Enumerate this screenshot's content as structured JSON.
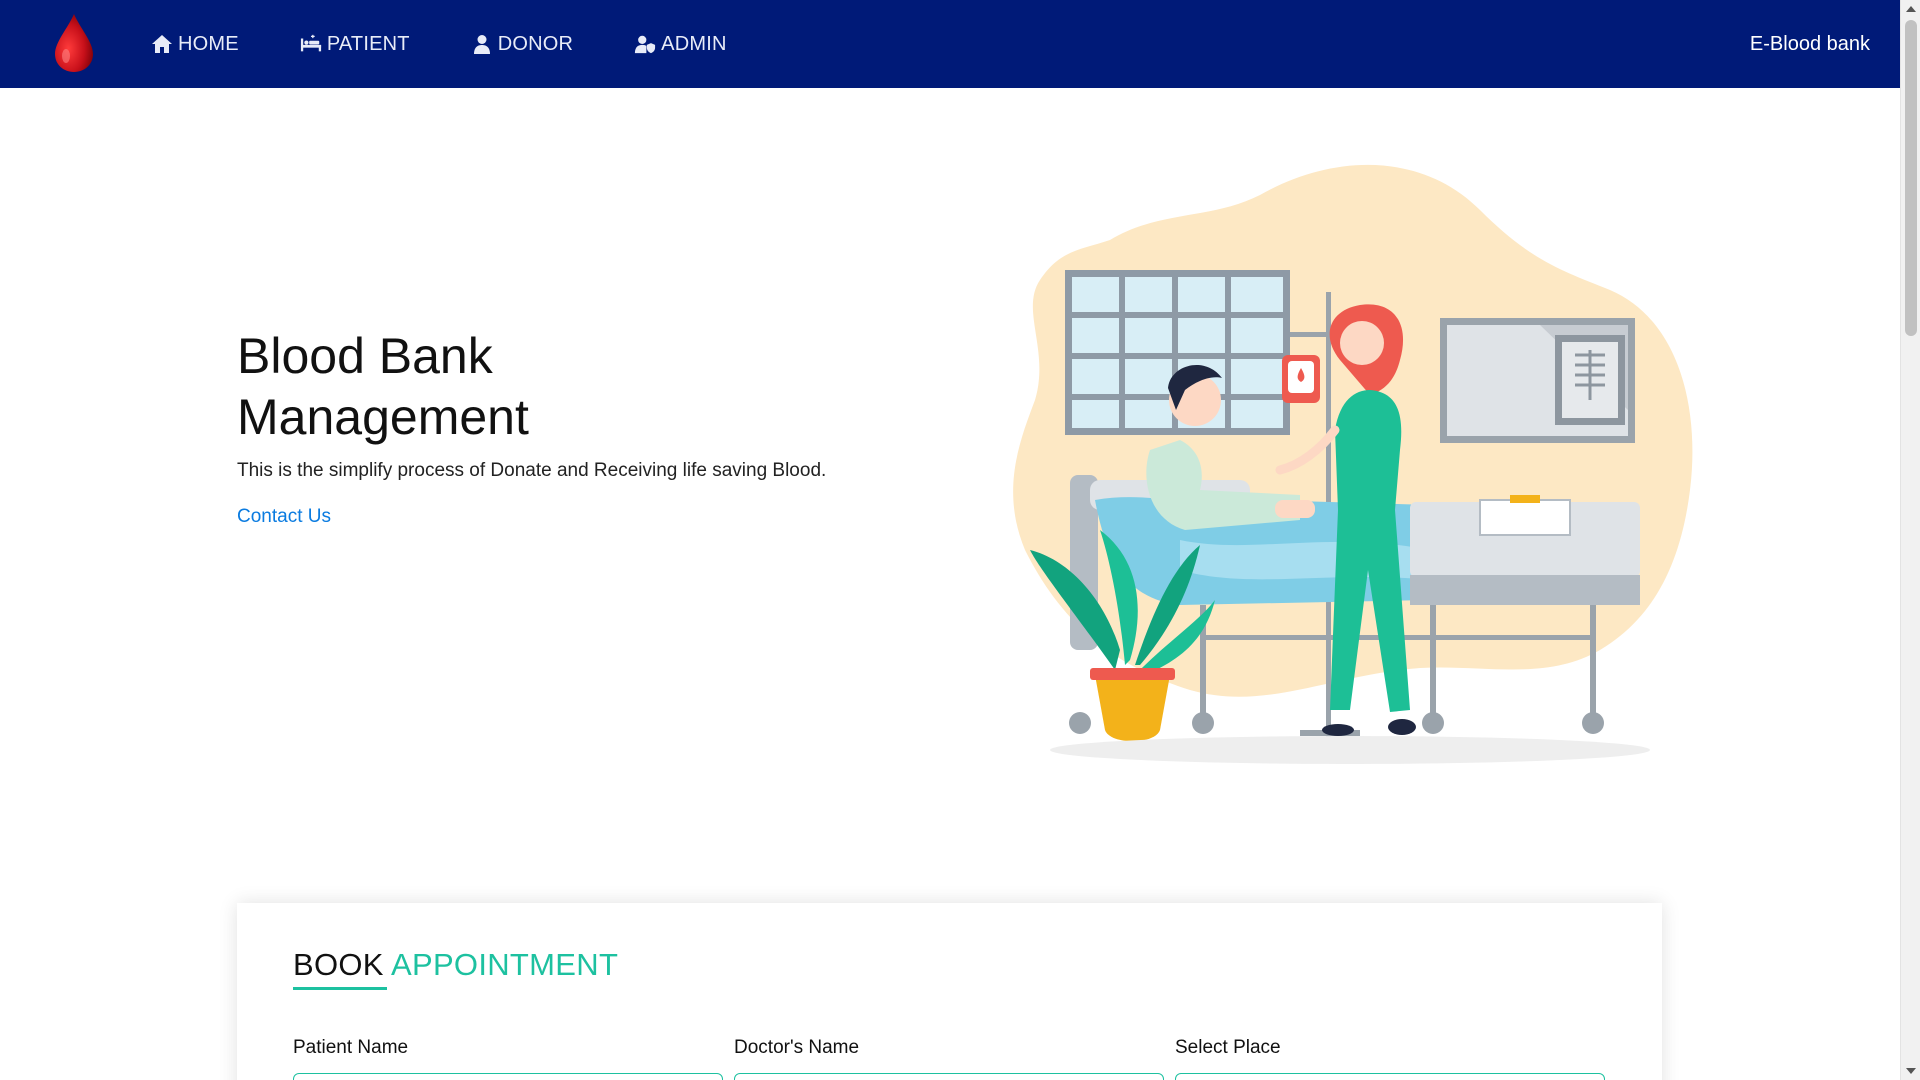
{
  "nav": {
    "items": [
      {
        "label": "HOME",
        "icon": "home-icon"
      },
      {
        "label": "PATIENT",
        "icon": "bed-icon"
      },
      {
        "label": "DONOR",
        "icon": "user-icon"
      },
      {
        "label": "ADMIN",
        "icon": "user-shield-icon"
      }
    ],
    "brand_right": "E-Blood bank",
    "logo_icon": "blood-drop-icon"
  },
  "hero": {
    "title": "Blood Bank Management",
    "subtitle": "This is the simplify process of Donate and Receiving life saving Blood.",
    "link": "Contact Us"
  },
  "appointment": {
    "title_part1": "BOOK",
    "title_part2": "APPOINTMENT",
    "fields": [
      {
        "label": "Patient Name"
      },
      {
        "label": "Doctor's Name"
      },
      {
        "label": "Select Place"
      }
    ]
  },
  "colors": {
    "navbar": "#001a78",
    "accent": "#1dc1a0",
    "link": "#0a7be0",
    "blood": "#d3151b"
  }
}
